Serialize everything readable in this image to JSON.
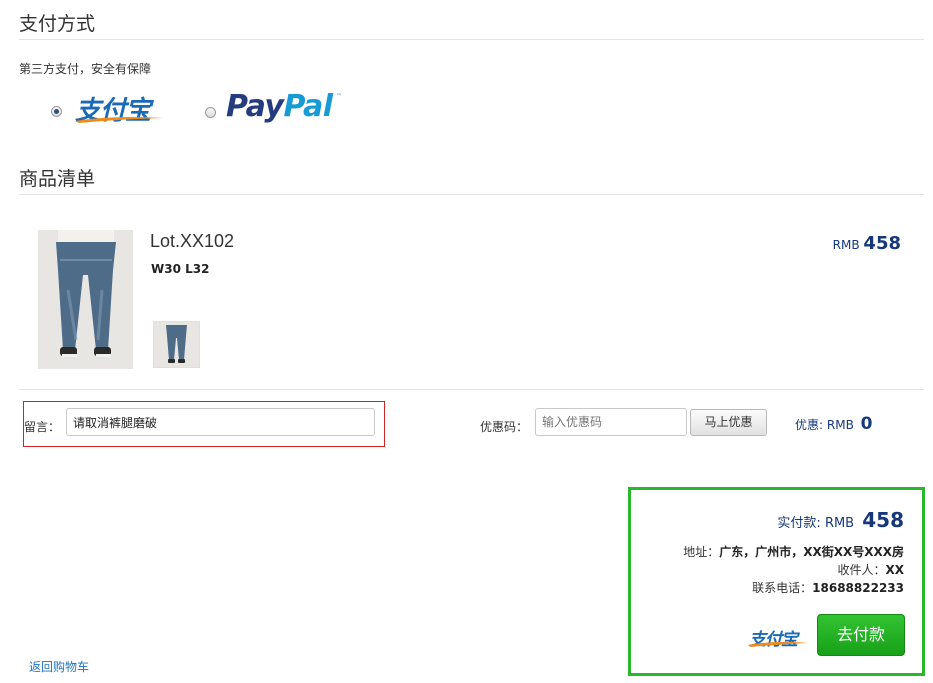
{
  "payment": {
    "title": "支付方式",
    "note": "第三方支付，安全有保障",
    "options": [
      {
        "name": "支付宝",
        "selected": true
      },
      {
        "name": "PayPal",
        "selected": false
      }
    ]
  },
  "cart": {
    "title": "商品清单",
    "item": {
      "name": "Lot.XX102",
      "size": "W30 L32",
      "currency": "RMB",
      "price": "458"
    }
  },
  "note": {
    "label": "留言：",
    "value": "请取消裤腿磨破"
  },
  "coupon": {
    "label": "优惠码：",
    "placeholder": "输入优惠码",
    "button": "马上优惠",
    "discount_label": "优惠:",
    "currency": "RMB",
    "discount_value": "0"
  },
  "summary": {
    "total_label": "实付款:",
    "currency": "RMB",
    "total_value": "458",
    "address_label": "地址：",
    "address_value": "广东，广州市，XX街XX号XXX房",
    "receiver_label": "收件人：",
    "receiver_value": "XX",
    "phone_label": "联系电话：",
    "phone_value": "18688822233",
    "alipay_mark": "支付宝",
    "pay_button": "去付款"
  },
  "back_link": "返回购物车",
  "colors": {
    "accent_blue": "#16387a",
    "pay_green": "#29b829",
    "note_border_red": "#d32424",
    "link_blue": "#1f74c2"
  }
}
